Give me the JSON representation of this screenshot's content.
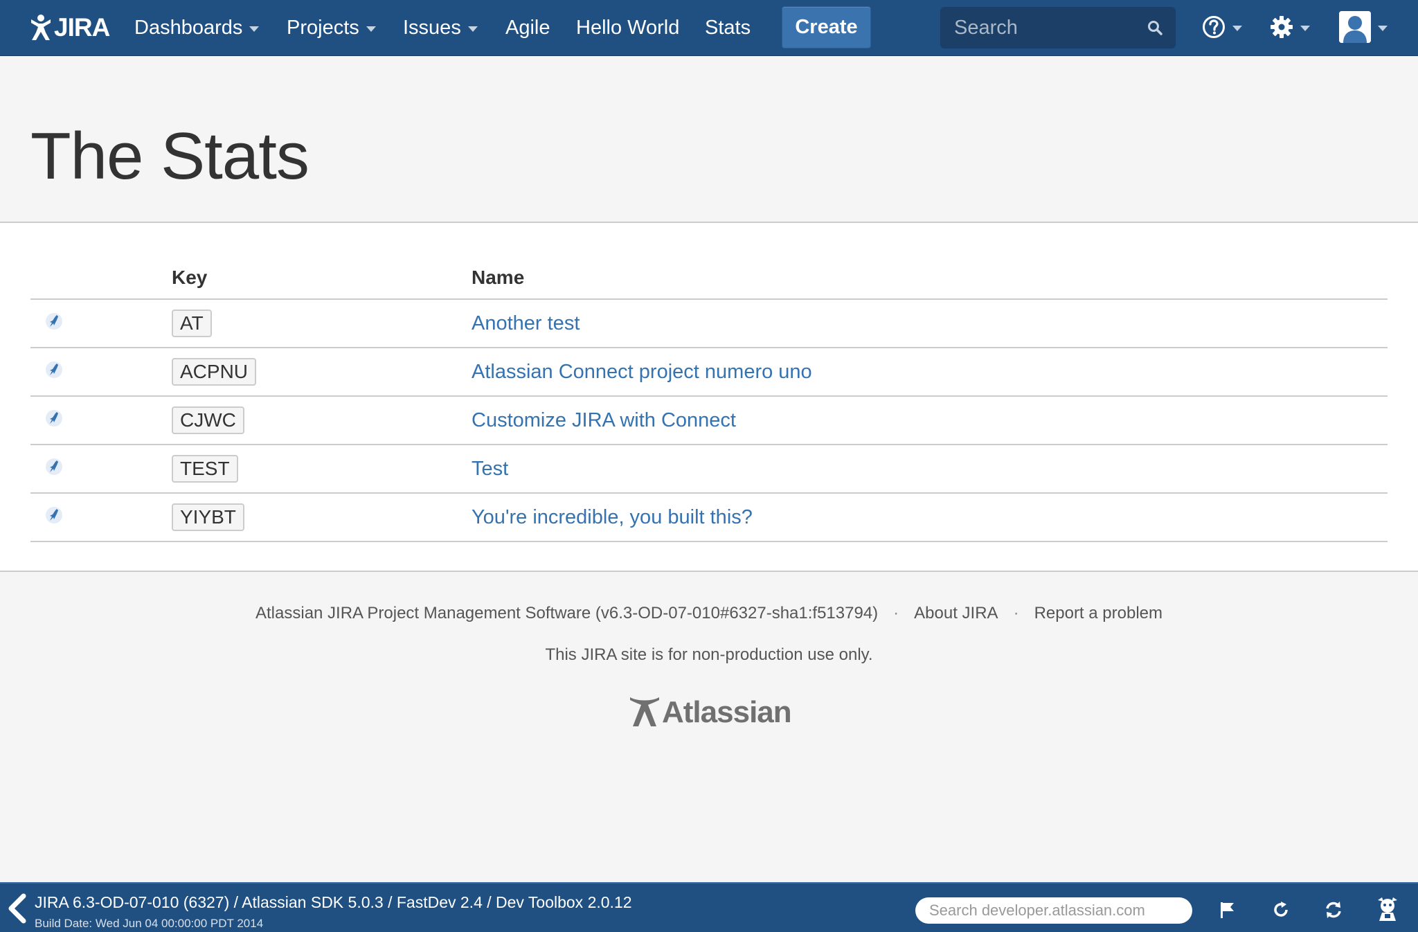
{
  "header": {
    "logo_text": "JIRA",
    "nav": [
      {
        "label": "Dashboards",
        "has_dropdown": true
      },
      {
        "label": "Projects",
        "has_dropdown": true
      },
      {
        "label": "Issues",
        "has_dropdown": true
      },
      {
        "label": "Agile",
        "has_dropdown": false
      },
      {
        "label": "Hello World",
        "has_dropdown": false
      },
      {
        "label": "Stats",
        "has_dropdown": false
      }
    ],
    "create_label": "Create",
    "search_placeholder": "Search",
    "icons": [
      "help-icon",
      "gear-icon",
      "avatar"
    ]
  },
  "page": {
    "title": "The Stats"
  },
  "table": {
    "headers": [
      "",
      "Key",
      "Name"
    ],
    "rows": [
      {
        "icon": "project-icon",
        "key": "AT",
        "name": "Another test"
      },
      {
        "icon": "project-icon",
        "key": "ACPNU",
        "name": "Atlassian Connect project numero uno"
      },
      {
        "icon": "project-icon",
        "key": "CJWC",
        "name": "Customize JIRA with Connect"
      },
      {
        "icon": "project-icon",
        "key": "TEST",
        "name": "Test"
      },
      {
        "icon": "project-icon",
        "key": "YIYBT",
        "name": "You're incredible, you built this?"
      }
    ]
  },
  "footer": {
    "software": "Atlassian JIRA Project Management Software (v6.3-OD-07-010#6327-sha1:f513794)",
    "about": "About JIRA",
    "report": "Report a problem",
    "notice": "This JIRA site is for non-production use only.",
    "logo_text": "Atlassian"
  },
  "devbar": {
    "title": "JIRA 6.3-OD-07-010 (6327) / Atlassian SDK 5.0.3 / FastDev 2.4 / Dev Toolbox 2.0.12",
    "build": "Build Date: Wed Jun 04 00:00:00 PDT 2014",
    "search_placeholder": "Search developer.atlassian.com",
    "icons": [
      "flag-icon",
      "refresh-icon",
      "sync-icon",
      "mascot-icon"
    ]
  },
  "colors": {
    "header_bg": "#205081",
    "create_bg": "#3b73af",
    "link": "#3572b0",
    "page_bg": "#f5f5f5"
  }
}
